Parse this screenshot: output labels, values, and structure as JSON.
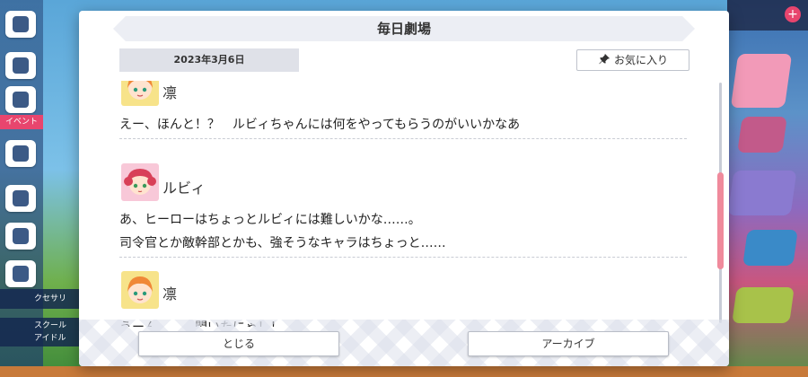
{
  "background": {
    "event_badge": "イベント",
    "tags": [
      "クセサリ",
      "スクール\nアイドル"
    ],
    "colors": {
      "pink": "#e8456e",
      "navy": "#3c5a86"
    }
  },
  "modal": {
    "title": "毎日劇場",
    "date": "2023年3月6日",
    "favorite_label": "お気に入り",
    "close_label": "とじる",
    "archive_label": "アーカイブ"
  },
  "log": {
    "entries": [
      {
        "speaker": "凛",
        "avatar": "rin-avatar",
        "lines": [
          "えー、ほんと！？　ルビィちゃんには何をやってもらうのがいいかなあ"
        ]
      },
      {
        "speaker": "ルビィ",
        "avatar": "ruby-avatar",
        "lines": [
          "あ、ヒーローはちょっとルビィには難しいかな……。",
          "司令官とか敵幹部とかも、強そうなキャラはちょっと……"
        ]
      },
      {
        "speaker": "凛",
        "avatar": "rin-avatar",
        "lines": [
          "うーん……。閃いたにゃ！！"
        ]
      }
    ]
  },
  "colors": {
    "accent": "#f08a9c",
    "panel": "#eceef4"
  }
}
